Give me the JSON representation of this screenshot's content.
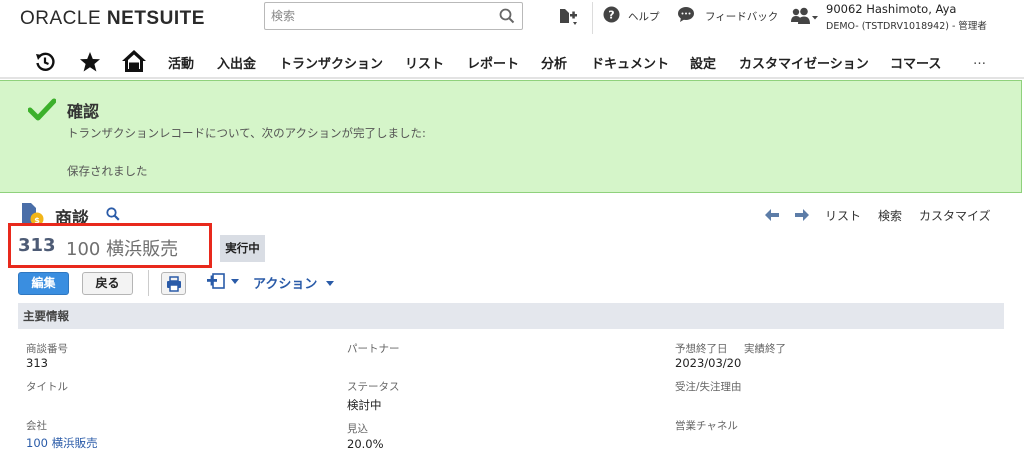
{
  "header": {
    "logo_left": "ORACLE",
    "logo_right": "NETSUITE",
    "search_placeholder": "検索",
    "help_label": "ヘルプ",
    "feedback_label": "フィードバック",
    "user_name": "90062 Hashimoto, Aya",
    "user_role": "DEMO- (TSTDRV1018942) - 管理者"
  },
  "nav": {
    "items": [
      "活動",
      "入出金",
      "トランザクション",
      "リスト",
      "レポート",
      "分析",
      "ドキュメント",
      "設定",
      "カスタマイゼーション",
      "コマース"
    ],
    "more": "…"
  },
  "confirmation": {
    "title": "確認",
    "message": "トランザクションレコードについて、次のアクションが完了しました:",
    "detail": "保存されました",
    "colors": {
      "background": "#d5f5c9",
      "check": "#3cb02b"
    }
  },
  "record": {
    "type": "商談",
    "number": "313",
    "name": "100 横浜販売",
    "status": "実行中",
    "nav_links": {
      "list": "リスト",
      "search": "検索",
      "customize": "カスタマイズ"
    }
  },
  "buttons": {
    "edit": "編集",
    "back": "戻る",
    "actions": "アクション"
  },
  "section": {
    "title": "主要情報",
    "fields": {
      "tranid_label": "商談番号",
      "tranid_value": "313",
      "partner_label": "パートナー",
      "expected_close_label": "予想終了日",
      "actual_close_label": "実績終了",
      "expected_close_value": "2023/03/20",
      "title_label": "タイトル",
      "status_label": "ステータス",
      "status_value": "検討中",
      "winloss_label": "受注/失注理由",
      "company_label": "会社",
      "company_value": "100 横浜販売",
      "probability_label": "見込",
      "probability_value": "20.0%",
      "channel_label": "営業チャネル"
    }
  },
  "accent_colors": {
    "primary_button": "#3a8ee0",
    "link": "#2a5ba8",
    "highlight_box": "#e8291c"
  }
}
